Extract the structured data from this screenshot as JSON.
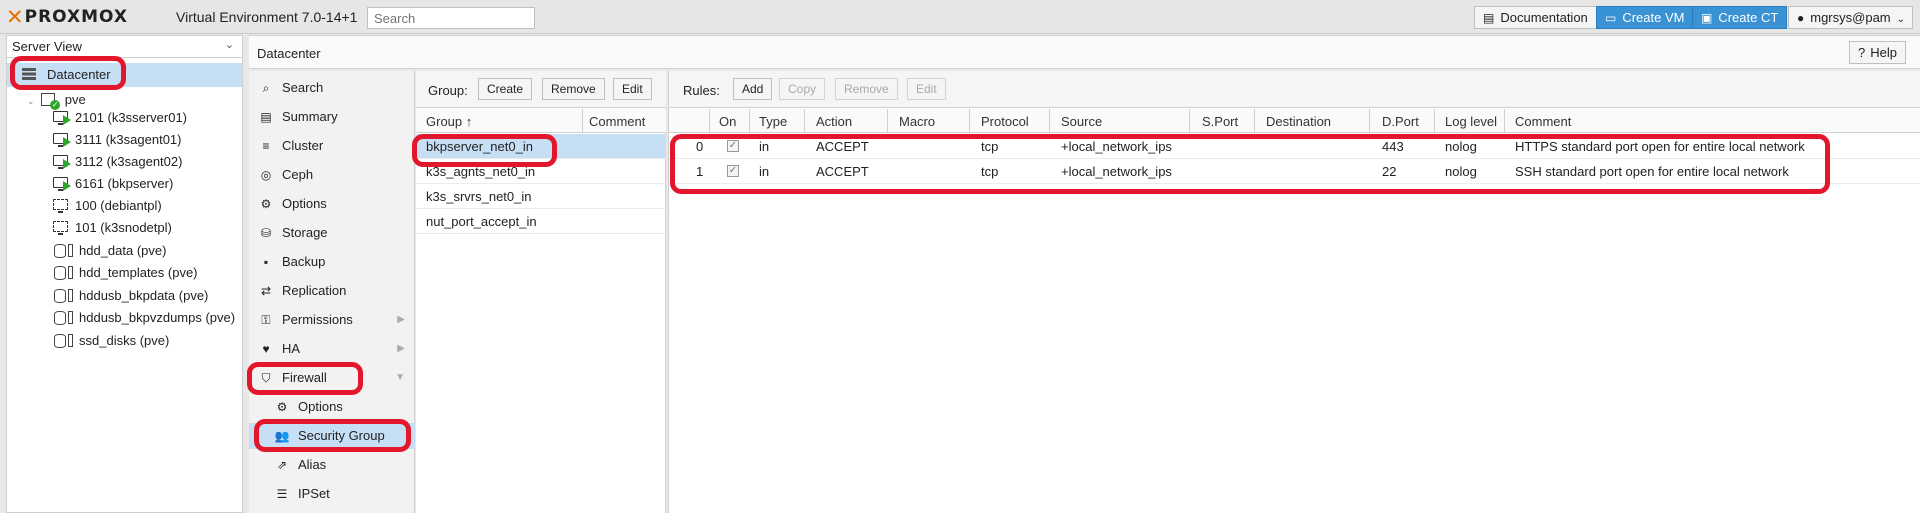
{
  "header": {
    "logo": "PROXMOX",
    "version": "Virtual Environment 7.0-14+1",
    "search_placeholder": "Search",
    "documentation": "Documentation",
    "create_vm": "Create VM",
    "create_ct": "Create CT",
    "user": "mgrsys@pam"
  },
  "tree": {
    "view": "Server View",
    "datacenter": "Datacenter",
    "node": "pve",
    "items": [
      {
        "label": "2101 (k3sserver01)",
        "kind": "vm-running"
      },
      {
        "label": "3111 (k3sagent01)",
        "kind": "vm-running"
      },
      {
        "label": "3112 (k3sagent02)",
        "kind": "vm-running"
      },
      {
        "label": "6161 (bkpserver)",
        "kind": "vm-running"
      },
      {
        "label": "100 (debiantpl)",
        "kind": "template"
      },
      {
        "label": "101 (k3snodetpl)",
        "kind": "template"
      },
      {
        "label": "hdd_data (pve)",
        "kind": "storage"
      },
      {
        "label": "hdd_templates (pve)",
        "kind": "storage"
      },
      {
        "label": "hddusb_bkpdata (pve)",
        "kind": "storage"
      },
      {
        "label": "hddusb_bkpvzdumps (pve)",
        "kind": "storage"
      },
      {
        "label": "ssd_disks (pve)",
        "kind": "storage"
      }
    ]
  },
  "main": {
    "title": "Datacenter",
    "help": "Help"
  },
  "menu": {
    "items": [
      {
        "label": "Search",
        "icon": "search-icon"
      },
      {
        "label": "Summary",
        "icon": "book-icon"
      },
      {
        "label": "Cluster",
        "icon": "server-icon"
      },
      {
        "label": "Ceph",
        "icon": "ceph-icon"
      },
      {
        "label": "Options",
        "icon": "gear-icon"
      },
      {
        "label": "Storage",
        "icon": "database-icon"
      },
      {
        "label": "Backup",
        "icon": "floppy-icon"
      },
      {
        "label": "Replication",
        "icon": "retweet-icon"
      },
      {
        "label": "Permissions",
        "icon": "unlock-icon"
      },
      {
        "label": "HA",
        "icon": "heartbeat-icon"
      },
      {
        "label": "Firewall",
        "icon": "shield-icon"
      },
      {
        "label": "Options",
        "icon": "gear-icon"
      },
      {
        "label": "Security Group",
        "icon": "users-icon"
      },
      {
        "label": "Alias",
        "icon": "external-link-icon"
      },
      {
        "label": "IPSet",
        "icon": "list-icon"
      }
    ]
  },
  "groups": {
    "toolbar_label": "Group:",
    "create": "Create",
    "remove": "Remove",
    "edit": "Edit",
    "col_group": "Group ↑",
    "col_comment": "Comment",
    "rows": [
      "bkpserver_net0_in",
      "k3s_agnts_net0_in",
      "k3s_srvrs_net0_in",
      "nut_port_accept_in"
    ]
  },
  "rules": {
    "toolbar_label": "Rules:",
    "add": "Add",
    "copy": "Copy",
    "remove": "Remove",
    "edit": "Edit",
    "columns": [
      "On",
      "Type",
      "Action",
      "Macro",
      "Protocol",
      "Source",
      "S.Port",
      "Destination",
      "D.Port",
      "Log level",
      "Comment"
    ],
    "rows": [
      {
        "pos": "0",
        "on": "✓",
        "type": "in",
        "action": "ACCEPT",
        "macro": "",
        "protocol": "tcp",
        "source": "+local_network_ips",
        "sport": "",
        "dest": "",
        "dport": "443",
        "log": "nolog",
        "comment": "HTTPS standard port open for entire local network"
      },
      {
        "pos": "1",
        "on": "✓",
        "type": "in",
        "action": "ACCEPT",
        "macro": "",
        "protocol": "tcp",
        "source": "+local_network_ips",
        "sport": "",
        "dest": "",
        "dport": "22",
        "log": "nolog",
        "comment": "SSH standard port open for entire local network"
      }
    ]
  }
}
